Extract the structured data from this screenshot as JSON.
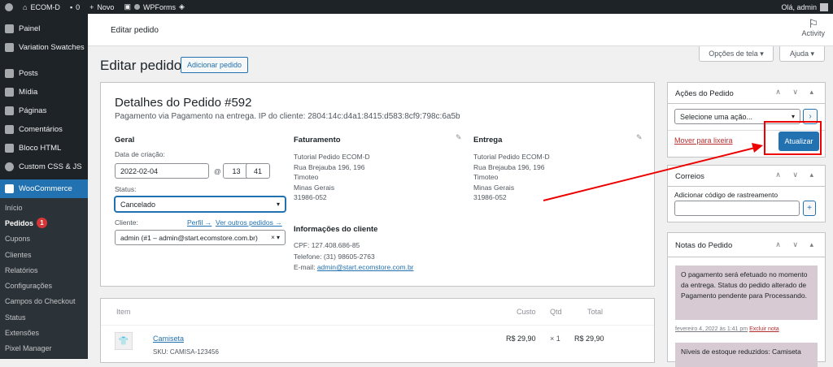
{
  "adminbar": {
    "site": "ECOM-D",
    "comments_count": "0",
    "new_label": "Novo",
    "wpforms": "WPForms",
    "greeting": "Olá, admin"
  },
  "sidebar": {
    "items": [
      {
        "label": "Painel",
        "icon": "dashboard-icon"
      },
      {
        "label": "Variation Swatches",
        "icon": "swatches-icon"
      },
      {
        "label": "Posts",
        "icon": "pin-icon"
      },
      {
        "label": "Mídia",
        "icon": "media-icon"
      },
      {
        "label": "Páginas",
        "icon": "pages-icon"
      },
      {
        "label": "Comentários",
        "icon": "comments-icon"
      },
      {
        "label": "Bloco HTML",
        "icon": "pin-icon"
      },
      {
        "label": "Custom CSS & JS",
        "icon": "plus-circle-icon"
      },
      {
        "label": "WooCommerce",
        "icon": "woo-icon"
      }
    ],
    "submenu": [
      "Início",
      "Pedidos",
      "Cupons",
      "Clientes",
      "Relatórios",
      "Configurações",
      "Campos do Checkout",
      "Status",
      "Extensões",
      "Pixel Manager"
    ],
    "orders_badge": "1"
  },
  "topbar": {
    "title": "Editar pedido",
    "activity": "Activity"
  },
  "screen_options": "Opções de tela ▾",
  "help": "Ajuda ▾",
  "page": {
    "title": "Editar pedido",
    "add_button": "Adicionar pedido"
  },
  "order": {
    "heading": "Detalhes do Pedido #592",
    "subtitle": "Pagamento via Pagamento na entrega. IP do cliente: 2804:14c:d4a1:8415:d583:8cf9:798c:6a5b",
    "general": {
      "title": "Geral",
      "created_label": "Data de criação:",
      "date": "2022-02-04",
      "at": "@",
      "hour": "13",
      "minute": "41",
      "status_label": "Status:",
      "status": "Cancelado",
      "customer_label": "Cliente:",
      "profile_link": "Perfil →",
      "other_orders_link": "Ver outros pedidos →",
      "customer": "admin (#1 – admin@start.ecomstore.com.br)"
    },
    "billing": {
      "title": "Faturamento",
      "lines": [
        "Tutorial Pedido ECOM-D",
        "Rua Brejauba 196, 196",
        "Timoteo",
        "Minas Gerais",
        "31986-052"
      ]
    },
    "shipping": {
      "title": "Entrega",
      "lines": [
        "Tutorial Pedido ECOM-D",
        "Rua Brejauba 196, 196",
        "Timoteo",
        "Minas Gerais",
        "31986-052"
      ]
    },
    "client_info": {
      "title": "Informações do cliente",
      "cpf": "CPF: 127.408.686-85",
      "phone": "Telefone: (31) 98605-2763",
      "email_label": "E-mail: ",
      "email": "admin@start.ecomstore.com.br"
    }
  },
  "items": {
    "headers": {
      "item": "Item",
      "cost": "Custo",
      "qty": "Qtd",
      "total": "Total"
    },
    "rows": [
      {
        "name": "Camiseta",
        "sku": "SKU: CAMISA-123456",
        "cost": "R$ 29,90",
        "qty": "× 1",
        "total": "R$ 29,90"
      }
    ]
  },
  "actions_box": {
    "title": "Ações do Pedido",
    "select": "Selecione uma ação...",
    "go": "›",
    "trash": "Mover para lixeira",
    "update": "Atualizar"
  },
  "correios_box": {
    "title": "Correios",
    "label": "Adicionar código de rastreamento",
    "add": "+"
  },
  "notes_box": {
    "title": "Notas do Pedido",
    "notes": [
      {
        "text": "O pagamento será efetuado no momento da entrega. Status do pedido alterado de Pagamento pendente para Processando.",
        "date": "fevereiro 4, 2022 às 1:41 pm",
        "delete": "Excluir nota"
      },
      {
        "text": "Níveis de estoque reduzidos: Camiseta"
      }
    ]
  },
  "panel_controls": "∧ ∨ ▴",
  "colors": {
    "accent": "#2271b1",
    "admin_bg": "#1d2327",
    "annotation": "#e00000",
    "note_bg": "#d7cad2"
  }
}
